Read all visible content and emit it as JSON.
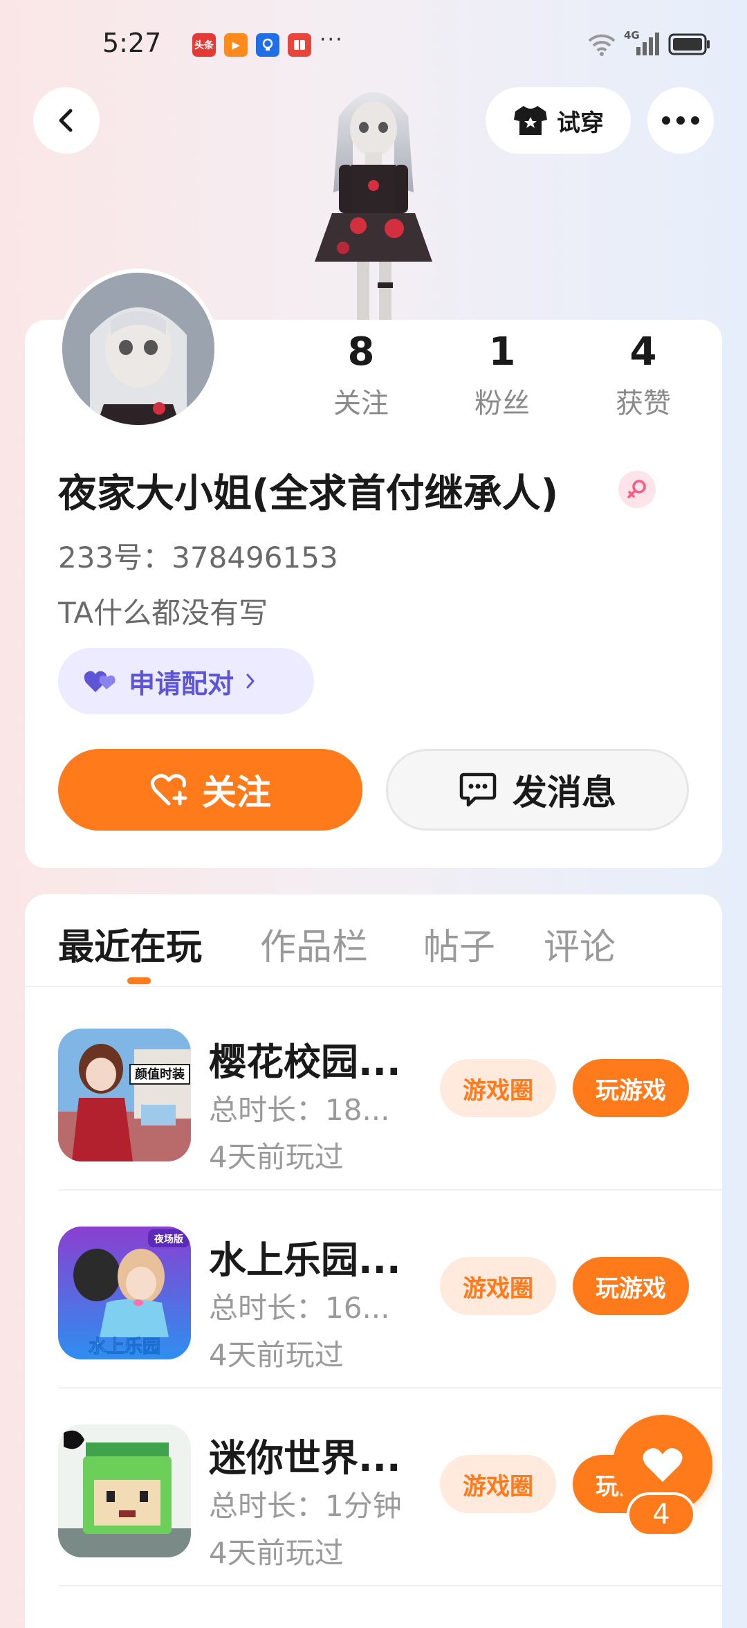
{
  "status_bar": {
    "time": "5:27",
    "notification_icons": [
      {
        "icon": "toutiao-app-icon",
        "text": "头条",
        "color": "#e53935"
      },
      {
        "icon": "video-app-icon",
        "text": "▶",
        "color": "#ff8a1c"
      },
      {
        "icon": "bulb-app-icon",
        "text": "",
        "color": "#1e6fe8"
      },
      {
        "icon": "book-app-icon",
        "text": "",
        "color": "#e8453c"
      }
    ],
    "more": "···",
    "network": "4G"
  },
  "header": {
    "back_icon": "chevron-left-icon",
    "tryon_label": "试穿",
    "tryon_icon": "shirt-icon",
    "more_icon": "more-dots-icon"
  },
  "profile": {
    "stats": [
      {
        "value": "8",
        "label": "关注"
      },
      {
        "value": "1",
        "label": "粉丝"
      },
      {
        "value": "4",
        "label": "获赞"
      }
    ],
    "username": "夜家大小姐(全求首付继承人)",
    "gender_icon": "female-icon",
    "user_id": "233号：378496153",
    "bio": "TA什么都没有写",
    "pair_label": "申请配对",
    "follow_label": "关注",
    "message_label": "发消息"
  },
  "tabs": [
    "最近在玩",
    "作品栏",
    "帖子",
    "评论"
  ],
  "games": [
    {
      "title": "樱花校园...",
      "duration": "总时长：18...",
      "last_played": "4天前玩过",
      "circle_label": "游戏圈",
      "play_label": "玩游戏",
      "icon_caption": "颜值时装"
    },
    {
      "title": "水上乐园...",
      "duration": "总时长：16...",
      "last_played": "4天前玩过",
      "circle_label": "游戏圈",
      "play_label": "玩游戏",
      "icon_caption": "水上乐园",
      "icon_badge": "夜场版"
    },
    {
      "title": "迷你世界...",
      "duration": "总时长：1分钟",
      "last_played": "4天前玩过",
      "circle_label": "游戏圈",
      "play_label": "玩游戏"
    }
  ],
  "floating_like": {
    "count": "4"
  },
  "colors": {
    "accent": "#ff7a1a",
    "pair_purple": "#5d54d6",
    "muted": "#9a9a9a"
  }
}
